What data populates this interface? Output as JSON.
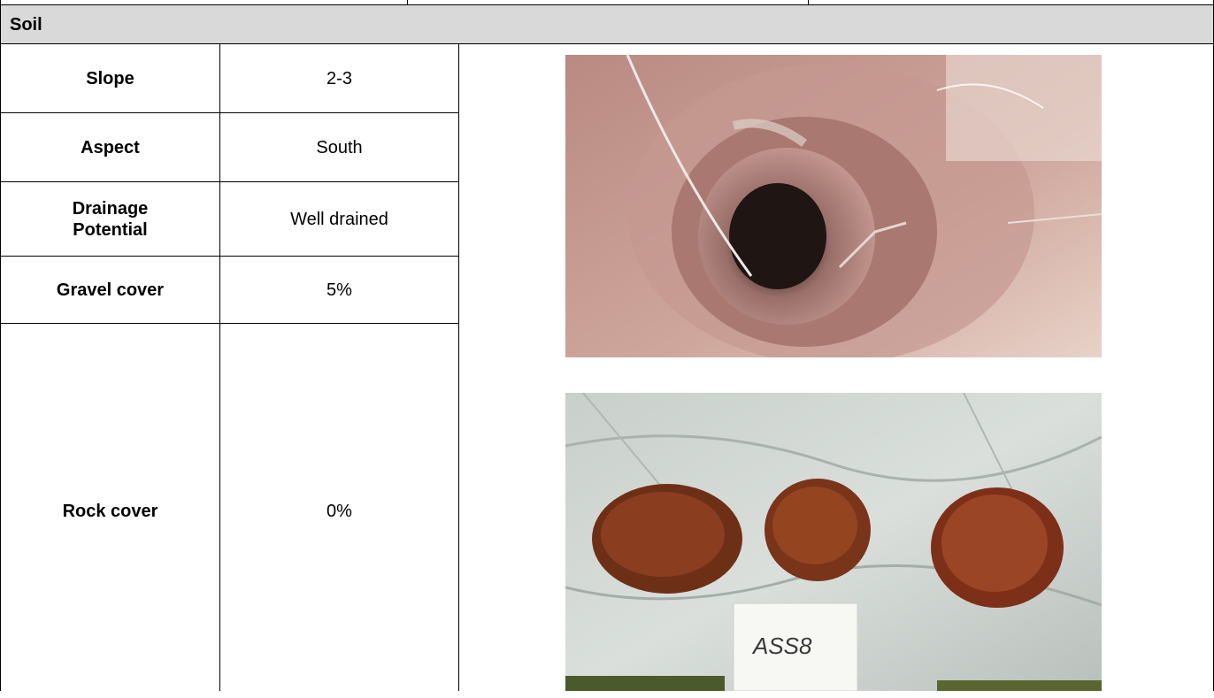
{
  "section_title": "Soil",
  "rows": [
    {
      "label": "Slope",
      "value": "2-3"
    },
    {
      "label": "Aspect",
      "value": "South"
    },
    {
      "label": "Drainage Potential",
      "value": "Well drained"
    },
    {
      "label": "Gravel cover",
      "value": "5%"
    },
    {
      "label": "Rock cover",
      "value": "0%"
    }
  ],
  "photos": {
    "soil_pit": {
      "description_icon": "soil-pit-photo"
    },
    "soil_samples": {
      "sample_tag": "ASS8"
    }
  },
  "colors": {
    "header_bg": "#d9d9d9",
    "border": "#000000",
    "soil": "#8a3a1f",
    "tarp": "#d8dcd9"
  }
}
